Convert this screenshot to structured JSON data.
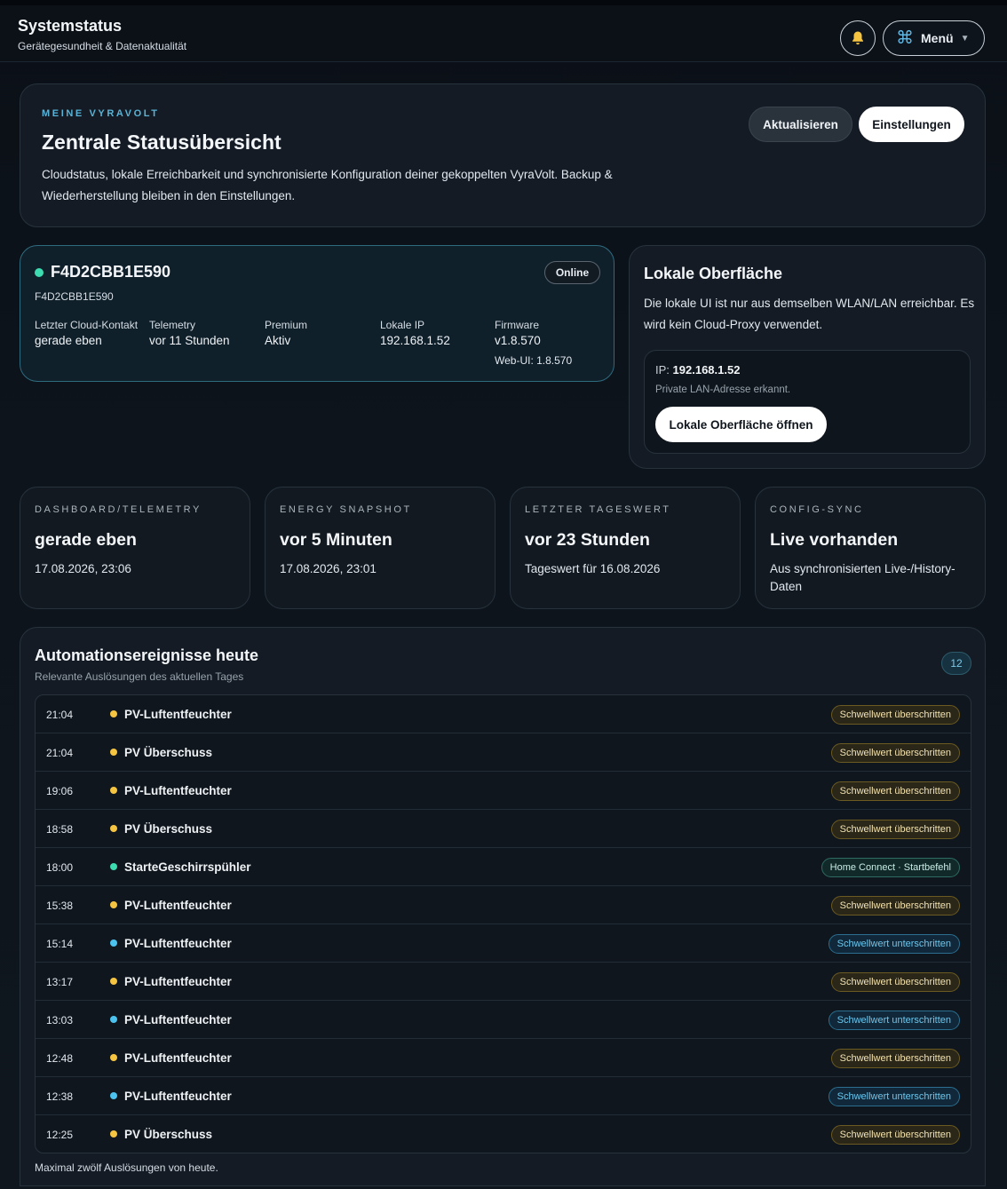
{
  "header": {
    "title": "Systemstatus",
    "subtitle": "Gerätegesundheit & Datenaktualität",
    "bell_icon": "bell-icon",
    "menu_icon": "command-icon",
    "menu_label": "Menü"
  },
  "hero": {
    "eyebrow": "MEINE VYRAVOLT",
    "title": "Zentrale Statusübersicht",
    "description": "Cloudstatus, lokale Erreichbarkeit und synchronisierte Konfiguration deiner gekoppelten VyraVolt. Backup & Wiederherstellung bleiben in den Einstellungen.",
    "refresh_label": "Aktualisieren",
    "settings_label": "Einstellungen"
  },
  "device": {
    "name": "F4D2CBB1E590",
    "id": "F4D2CBB1E590",
    "status": "Online",
    "status_color": "#3ddbb0",
    "stats": [
      {
        "label": "Letzter Cloud-Kontakt",
        "value": "gerade eben"
      },
      {
        "label": "Telemetry",
        "value": "vor 11 Stunden"
      },
      {
        "label": "Premium",
        "value": "Aktiv"
      },
      {
        "label": "Lokale IP",
        "value": "192.168.1.52"
      },
      {
        "label": "Firmware",
        "value": "v1.8.570",
        "extra": "Web-UI: 1.8.570"
      }
    ]
  },
  "local_ui": {
    "title": "Lokale Oberfläche",
    "description": "Die lokale UI ist nur aus demselben WLAN/LAN erreichbar. Es wird kein Cloud-Proxy verwendet.",
    "ip_label": "IP:",
    "ip_value": "192.168.1.52",
    "note": "Private LAN-Adresse erkannt.",
    "open_label": "Lokale Oberfläche öffnen"
  },
  "stat_cards": [
    {
      "eyebrow": "DASHBOARD/TELEMETRY",
      "value": "gerade eben",
      "detail": "17.08.2026, 23:06"
    },
    {
      "eyebrow": "ENERGY SNAPSHOT",
      "value": "vor 5 Minuten",
      "detail": "17.08.2026, 23:01"
    },
    {
      "eyebrow": "LETZTER TAGESWERT",
      "value": "vor 23 Stunden",
      "detail": "Tageswert für 16.08.2026"
    },
    {
      "eyebrow": "CONFIG-SYNC",
      "value": "Live vorhanden",
      "detail": "Aus synchronisierten Live-/History-Daten"
    }
  ],
  "automation": {
    "title": "Automationsereignisse heute",
    "subtitle": "Relevante Auslösungen des aktuellen Tages",
    "count": "12",
    "footnote": "Maximal zwölf Auslösungen von heute.",
    "colors": {
      "over": "#f5c542",
      "under": "#4cc3ee",
      "home": "#3ddbb0"
    },
    "events": [
      {
        "time": "21:04",
        "name": "PV-Luftentfeuchter",
        "tag": "Schwellwert überschritten",
        "kind": "over"
      },
      {
        "time": "21:04",
        "name": "PV Überschuss",
        "tag": "Schwellwert überschritten",
        "kind": "over"
      },
      {
        "time": "19:06",
        "name": "PV-Luftentfeuchter",
        "tag": "Schwellwert überschritten",
        "kind": "over"
      },
      {
        "time": "18:58",
        "name": "PV Überschuss",
        "tag": "Schwellwert überschritten",
        "kind": "over"
      },
      {
        "time": "18:00",
        "name": "StarteGeschirrspühler",
        "tag": "Home Connect · Startbefehl",
        "kind": "hc"
      },
      {
        "time": "15:38",
        "name": "PV-Luftentfeuchter",
        "tag": "Schwellwert überschritten",
        "kind": "over"
      },
      {
        "time": "15:14",
        "name": "PV-Luftentfeuchter",
        "tag": "Schwellwert unterschritten",
        "kind": "under"
      },
      {
        "time": "13:17",
        "name": "PV-Luftentfeuchter",
        "tag": "Schwellwert überschritten",
        "kind": "over"
      },
      {
        "time": "13:03",
        "name": "PV-Luftentfeuchter",
        "tag": "Schwellwert unterschritten",
        "kind": "under"
      },
      {
        "time": "12:48",
        "name": "PV-Luftentfeuchter",
        "tag": "Schwellwert überschritten",
        "kind": "over"
      },
      {
        "time": "12:38",
        "name": "PV-Luftentfeuchter",
        "tag": "Schwellwert unterschritten",
        "kind": "under"
      },
      {
        "time": "12:25",
        "name": "PV Überschuss",
        "tag": "Schwellwert überschritten",
        "kind": "over"
      }
    ]
  }
}
